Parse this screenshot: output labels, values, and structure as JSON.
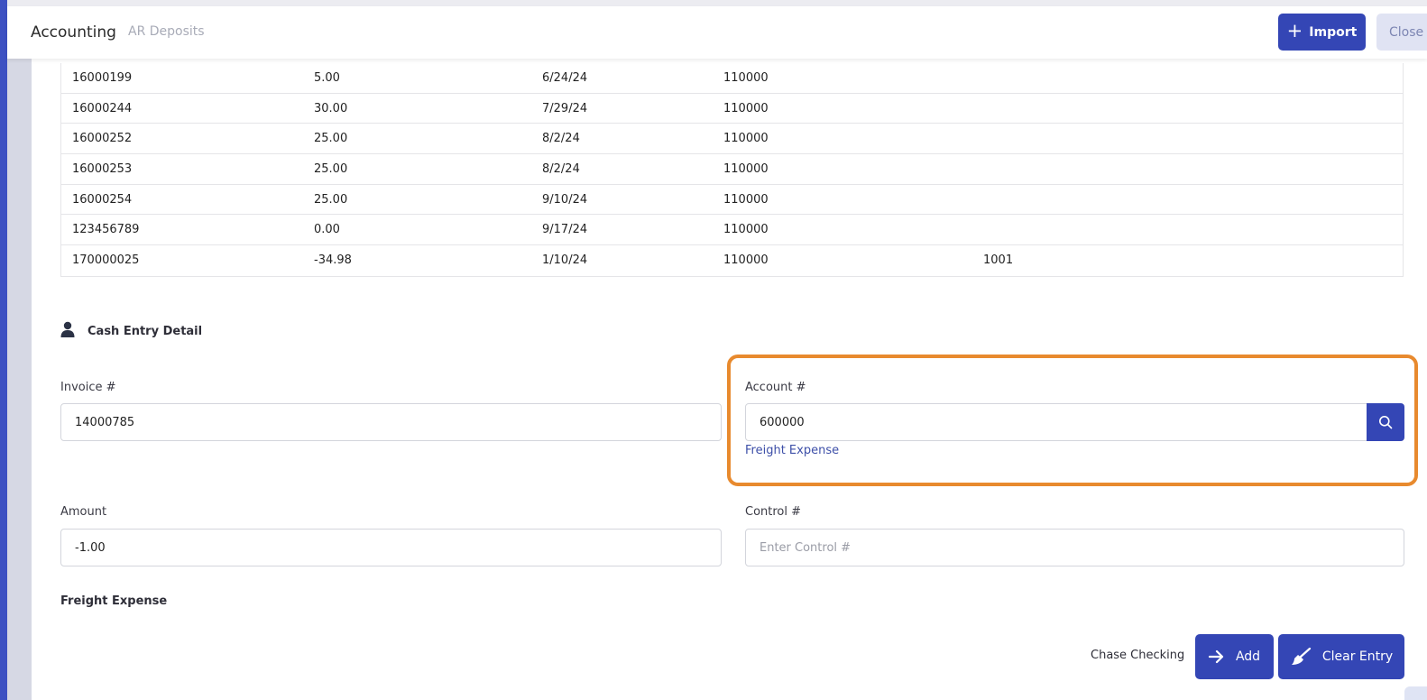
{
  "header": {
    "title": "Accounting",
    "breadcrumb": "AR Deposits",
    "import_label": "Import",
    "close_label": "Close"
  },
  "table": {
    "rows": [
      [
        "16000199",
        "5.00",
        "6/24/24",
        "110000",
        ""
      ],
      [
        "16000244",
        "30.00",
        "7/29/24",
        "110000",
        ""
      ],
      [
        "16000252",
        "25.00",
        "8/2/24",
        "110000",
        ""
      ],
      [
        "16000253",
        "25.00",
        "8/2/24",
        "110000",
        ""
      ],
      [
        "16000254",
        "25.00",
        "9/10/24",
        "110000",
        ""
      ],
      [
        "123456789",
        "0.00",
        "9/17/24",
        "110000",
        ""
      ],
      [
        "170000025",
        "-34.98",
        "1/10/24",
        "110000",
        "1001"
      ]
    ]
  },
  "section": {
    "title": "Cash Entry Detail"
  },
  "form": {
    "invoice_label": "Invoice #",
    "invoice_value": "14000785",
    "account_label": "Account #",
    "account_value": "600000",
    "account_hint": "Freight Expense",
    "amount_label": "Amount",
    "amount_value": "-1.00",
    "control_label": "Control #",
    "control_placeholder": "Enter Control #"
  },
  "footer": {
    "account_name": "Freight Expense",
    "bank_name": "Chase Checking",
    "add_label": "Add",
    "clear_label": "Clear Entry"
  },
  "colors": {
    "primary": "#3446b5",
    "highlight": "#e88a2e",
    "hint": "#3d4fa8"
  }
}
